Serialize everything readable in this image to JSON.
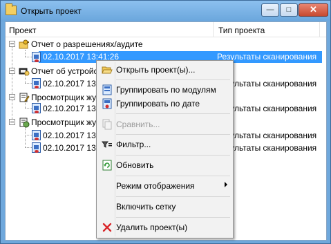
{
  "window": {
    "title": "Открыть проект",
    "controls": {
      "minimize": "—",
      "maximize": "□",
      "close": "✕"
    }
  },
  "header": {
    "project": "Проект",
    "type": "Тип проекта"
  },
  "tree": [
    {
      "label": "Отчет о разрешениях/аудите",
      "icon": "key-folder-icon"
    },
    {
      "label": "02.10.2017 13:41:26",
      "type": "Результаты сканирования",
      "selected": true
    },
    {
      "label": "Отчет об устройс",
      "icon": "device-report-icon"
    },
    {
      "label": "02.10.2017 13:",
      "type": "Результаты сканирования"
    },
    {
      "label": "Просмотрщик жу",
      "icon": "log-viewer-icon"
    },
    {
      "label": "02.10.2017 13:",
      "type": "Результаты сканирования"
    },
    {
      "label": "Просмотрщик жу",
      "icon": "log-viewer-icon"
    },
    {
      "label": "02.10.2017 13:",
      "type": "Результаты сканирования"
    },
    {
      "label": "02.10.2017 13:",
      "type": "Результаты сканирования"
    }
  ],
  "context_menu": [
    {
      "label": "Открыть проект(ы)...",
      "icon": "open-folder-icon",
      "enabled": true
    },
    {
      "label": "Группировать по модулям",
      "icon": "group-modules-icon",
      "enabled": true
    },
    {
      "label": "Группировать по дате",
      "icon": "group-date-icon",
      "enabled": true
    },
    {
      "label": "Сравнить...",
      "icon": "compare-icon",
      "enabled": false
    },
    {
      "label": "Фильтр...",
      "icon": "filter-icon",
      "enabled": true
    },
    {
      "label": "Обновить",
      "icon": "refresh-icon",
      "enabled": true
    },
    {
      "label": "Режим отображения",
      "icon": "",
      "enabled": true,
      "submenu": true
    },
    {
      "label": "Включить сетку",
      "icon": "",
      "enabled": true
    },
    {
      "label": "Удалить проект(ы)",
      "icon": "delete-icon",
      "enabled": true
    }
  ],
  "colors": {
    "selection": "#3399ff",
    "titlebar": "#6fa8dc",
    "delete": "#d9262a"
  }
}
